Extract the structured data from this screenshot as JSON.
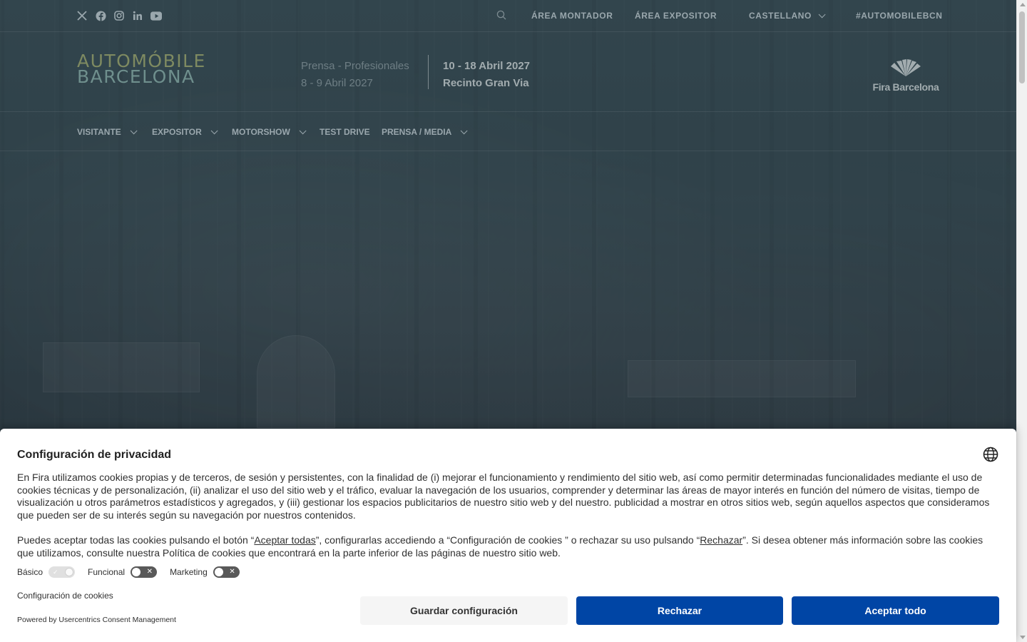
{
  "social": {
    "icons": [
      "x-icon",
      "facebook-icon",
      "instagram-icon",
      "linkedin-icon",
      "youtube-icon"
    ]
  },
  "topbar": {
    "links": {
      "area_montador": "ÁREA MONTADOR",
      "area_expositor": "ÁREA EXPOSITOR",
      "language": "CASTELLANO",
      "hashtag": "#AUTOMOBILEBCN"
    }
  },
  "brand": {
    "logo_line1": "AUTOMÓBILE",
    "logo_line2": "BARCELONA",
    "press_label": "Prensa - Profesionales",
    "press_dates": "8 - 9 Abril 2027",
    "public_dates": "10 - 18 Abril 2027",
    "venue": "Recinto Gran Via",
    "fira_name": "Fira Barcelona"
  },
  "nav": {
    "visitante": "VISITANTE",
    "expositor": "EXPOSITOR",
    "motorshow": "MOTORSHOW",
    "test_drive": "TEST DRIVE",
    "prensa": "PRENSA / MEDIA"
  },
  "cookie": {
    "title": "Configuración de privacidad",
    "p1": "En Fira utilizamos cookies propias y de terceros, de sesión y persistentes, con la finalidad de (i) mejorar el funcionamiento y rendimiento del sitio web, así como permitir determinadas funcionalidades mediante el uso de cookies técnicas y de personalización, (ii) analizar el uso del sitio web y el tráfico, evaluar la navegación de los usuarios, comprender y determinar las áreas de mayor interés en función del número de visitas, tiempo de visualización u otros parámetros estadísticos y agregados, y (iii) gestionar los espacios publicitarios de nuestro sitio web y del nuestro. publicidad a mostrar en otros sitios web, según aquellos aspectos que consideramos que pueden ser de su interés según su navegación por nuestros contenidos.",
    "p2_a": "Puedes aceptar todas las cookies pulsando el botón “",
    "p2_link_accept": "Aceptar todas",
    "p2_b": "”, configurarlas accediendo a “Configuración de cookies ” o rechazar su uso pulsando “",
    "p2_link_reject": "Rechazar",
    "p2_c": "”. Si desea obtener más información sobre las cookies que utilizamos, consulte nuestra Política de cookies que encontrará en la parte inferior de las páginas de nuestro sitio web.",
    "toggles": {
      "basic": "Básico",
      "functional": "Funcional",
      "marketing": "Marketing"
    },
    "config_link": "Configuración de cookies",
    "powered": "Powered by Usercentrics Consent Management",
    "buttons": {
      "save": "Guardar configuración",
      "reject": "Rechazar",
      "accept": "Aceptar todo"
    },
    "colors": {
      "primary": "#0045a5",
      "secondary": "#f5f5f5"
    }
  }
}
